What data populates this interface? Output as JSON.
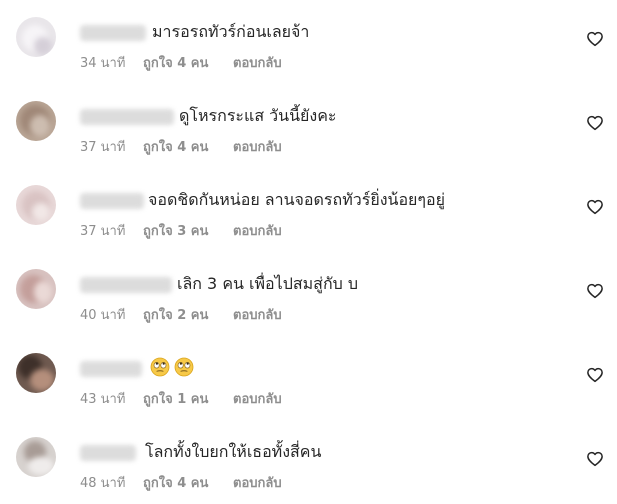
{
  "comments": [
    {
      "text": "มารอรถทัวร์ก่อนเลยจ้า",
      "time": "34 นาที",
      "likes": "ถูกใจ 4 คน",
      "reply": "ตอบกลับ"
    },
    {
      "text": "ดูโหรกระแส วันนี้ยังคะ",
      "time": "37 นาที",
      "likes": "ถูกใจ 4 คน",
      "reply": "ตอบกลับ"
    },
    {
      "text": "จอดชิดกันหน่อย ลานจอดรถทัวร์ยิ่งน้อยๆอยู่",
      "time": "37 นาที",
      "likes": "ถูกใจ 3 คน",
      "reply": "ตอบกลับ"
    },
    {
      "text": "เลิก 3 คน เพื่อไปสมสู่กับ บ",
      "time": "40 นาที",
      "likes": "ถูกใจ 2 คน",
      "reply": "ตอบกลับ"
    },
    {
      "text": "",
      "time": "43 นาที",
      "likes": "ถูกใจ 1 คน",
      "reply": "ตอบกลับ",
      "emoji": [
        "face-with-rolling-eyes-icon",
        "face-with-rolling-eyes-icon"
      ]
    },
    {
      "text": "โลกทั้งใบยกให้เธอทั้งสี่คน",
      "time": "48 นาที",
      "likes": "ถูกใจ 4 คน",
      "reply": "ตอบกลับ"
    }
  ]
}
